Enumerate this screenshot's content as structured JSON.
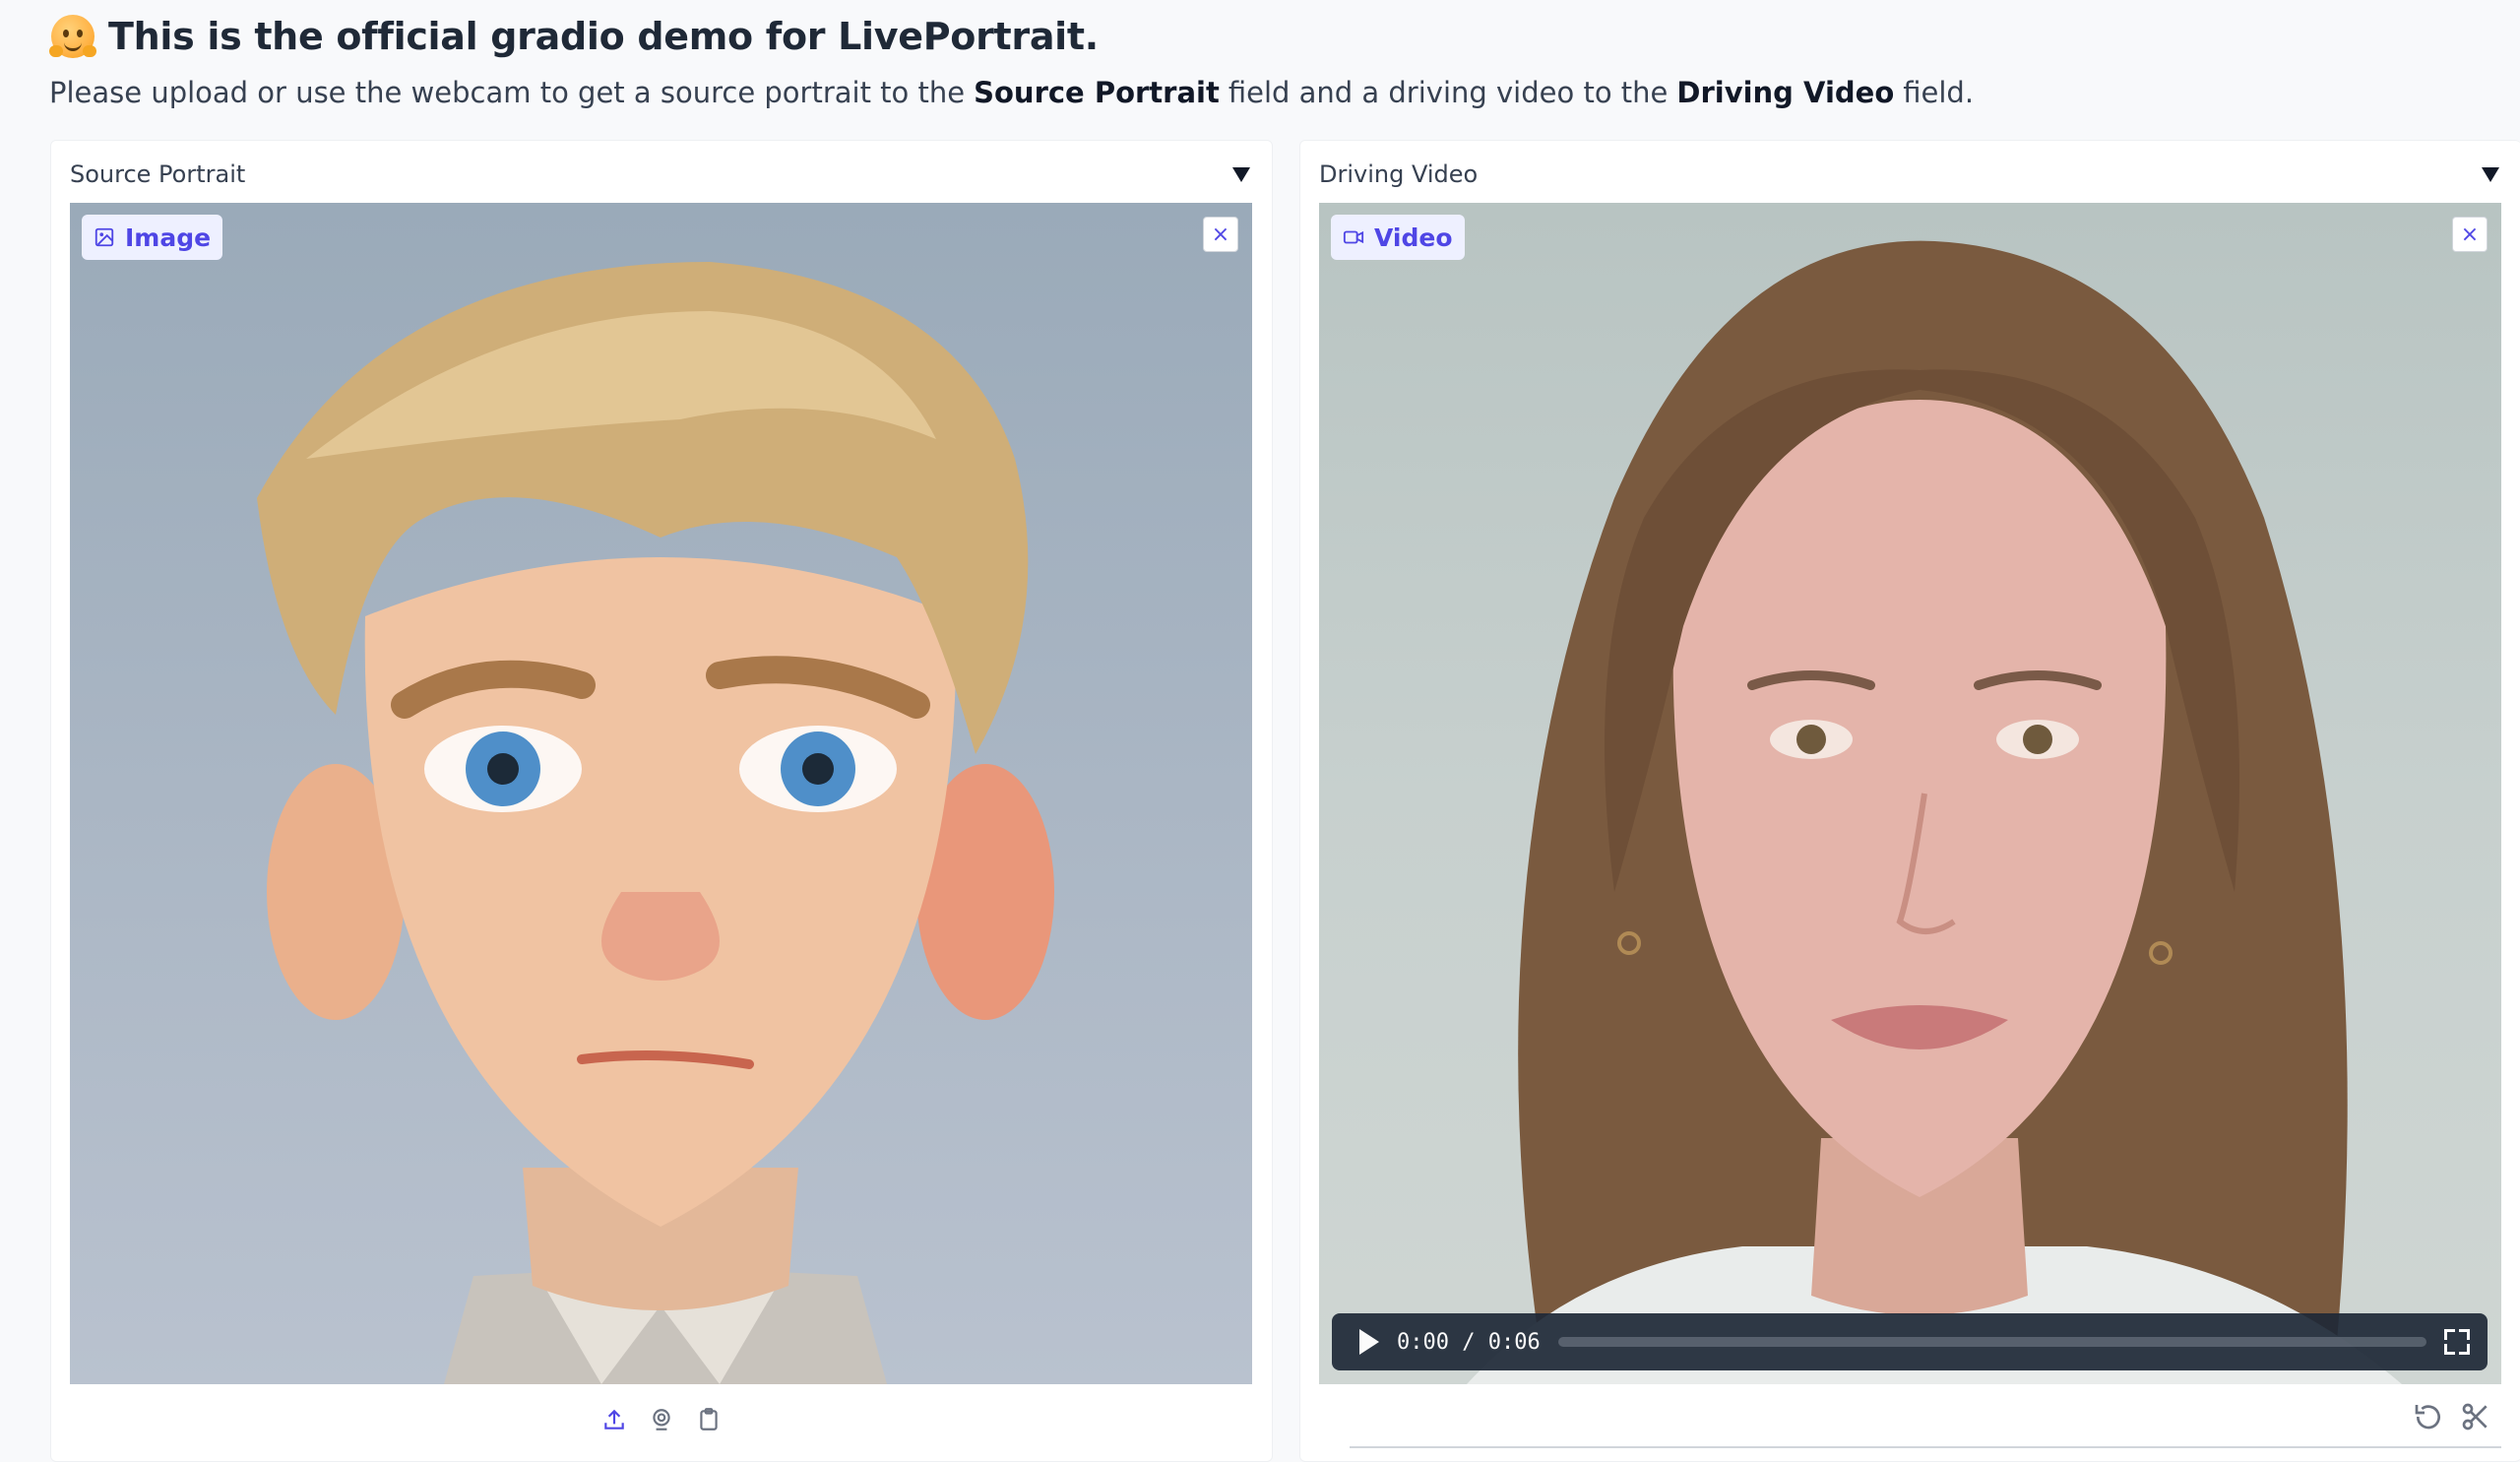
{
  "header": {
    "title": "This is the official gradio demo for LivePortrait.",
    "desc_pre": "Please upload or use the webcam to get a source portrait to the",
    "desc_bold1": "Source Portrait",
    "desc_mid": "field and a driving video to the",
    "desc_bold2": "Driving Video",
    "desc_post": "field."
  },
  "source_panel": {
    "label": "Source Portrait",
    "badge": "Image"
  },
  "driving_panel": {
    "label": "Driving Video",
    "badge": "Video",
    "time": "0:00 / 0:06",
    "progress": 0
  },
  "colors": {
    "accent": "#4f46e5",
    "badge_bg": "#eef0ff",
    "page_bg": "#f8f9fb"
  },
  "icons": {
    "close": "close-icon",
    "upload": "upload-icon",
    "webcam": "webcam-icon",
    "clipboard": "clipboard-icon",
    "undo": "undo-icon",
    "trim": "scissors-icon"
  }
}
